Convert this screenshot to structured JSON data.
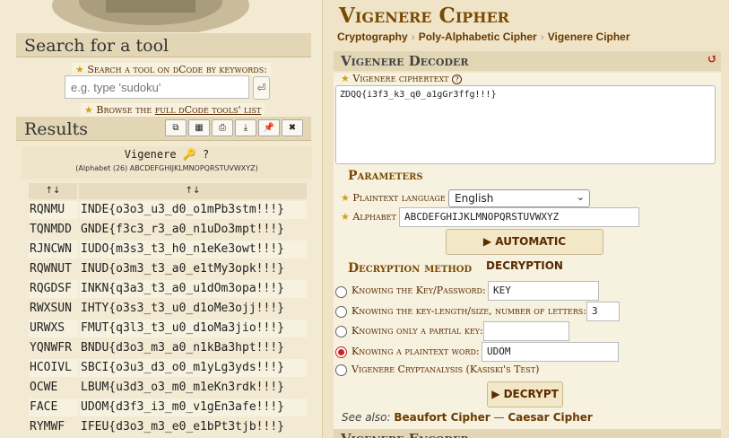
{
  "left": {
    "search_title": "Search for a tool",
    "search_keywords_link": "Search a tool on dCode by keywords:",
    "search_placeholder": "e.g. type 'sudoku'",
    "search_go": "⏎",
    "browse_prefix": "Browse the ",
    "browse_link": "full dCode tools' list",
    "results_title": "Results",
    "result_buttons": [
      "⧉",
      "▦",
      "⎙",
      "⤓",
      "📌",
      "✖"
    ],
    "result_tool_name": "Vigenere 🔑 ?",
    "result_alphabet": "(Alphabet (26) ABCDEFGHIJKLMNOPQRSTUVWXYZ)",
    "col_heads": [
      "↑↓",
      "↑↓"
    ],
    "rows": [
      {
        "key": "RQNMU",
        "text": "INDE{o3o3_u3_d0_o1mPb3stm!!!}"
      },
      {
        "key": "TQNMDD",
        "text": "GNDE{f3c3_r3_a0_n1uDo3mpt!!!}"
      },
      {
        "key": "RJNCWN",
        "text": "IUDO{m3s3_t3_h0_n1eKe3owt!!!}"
      },
      {
        "key": "RQWNUT",
        "text": "INUD{o3m3_t3_a0_e1tMy3opk!!!}"
      },
      {
        "key": "RQGDSF",
        "text": "INKN{q3a3_t3_a0_u1dOm3opa!!!}"
      },
      {
        "key": "RWXSUN",
        "text": "IHTY{o3s3_t3_u0_d1oMe3ojj!!!}"
      },
      {
        "key": "URWXS",
        "text": "FMUT{q3l3_t3_u0_d1oMa3jio!!!}"
      },
      {
        "key": "YQNWFR",
        "text": "BNDU{d3o3_m3_a0_n1kBa3hpt!!!}"
      },
      {
        "key": "HCOIVL",
        "text": "SBCI{o3u3_d3_o0_m1yLg3yds!!!}"
      },
      {
        "key": "OCWE",
        "text": "LBUM{u3d3_o3_m0_m1eKn3rdk!!!}"
      },
      {
        "key": "FACE",
        "text": "UDOM{d3f3_i3_m0_v1gEn3afe!!!}"
      },
      {
        "key": "RYMWF",
        "text": "IFEU{d3o3_m3_e0_e1bPt3tjb!!!}"
      }
    ]
  },
  "right": {
    "title": "Vigenere Cipher",
    "breadcrumbs": [
      "Cryptography",
      "Poly-Alphabetic Cipher",
      "Vigenere Cipher"
    ],
    "decoder_title": "Vigenere Decoder",
    "refresh_icon": "↺",
    "ciphertext_label": "Vigenere ciphertext",
    "help_icon": "?",
    "ciphertext": "ZDQQ{i3f3_k3_q0_a1gGr3ffg!!!}",
    "parameters_title": "Parameters",
    "plaintext_language_label": "Plaintext language",
    "plaintext_language_value": "English",
    "alphabet_label": "Alphabet",
    "alphabet_value": "ABCDEFGHIJKLMNOPQRSTUVWXYZ",
    "auto_decrypt_label": "▶ AUTOMATIC DECRYPTION",
    "method_title": "Decryption method",
    "methods": [
      {
        "label": "Knowing the Key/Password:",
        "value": "KEY",
        "selected": false
      },
      {
        "label": "Knowing the key-length/size, number of letters:",
        "value": "3",
        "selected": false
      },
      {
        "label": "Knowing only a partial key:",
        "value": "",
        "selected": false
      },
      {
        "label": "Knowing a plaintext word:",
        "value": "UDOM",
        "selected": true
      },
      {
        "label": "Vigenere Cryptanalysis (Kasiski's Test)",
        "value": "",
        "selected": false
      }
    ],
    "decrypt_label": "▶ DECRYPT",
    "see_also_prefix": "See also:",
    "see_also": [
      "Beaufort Cipher",
      "Caesar Cipher"
    ],
    "see_also_sep": "—",
    "encoder_title": "Vigenere Encoder"
  },
  "colors": {
    "accent_brown": "#7a4a00",
    "selected_radio": "#cc2222",
    "star": "#d4a017"
  }
}
